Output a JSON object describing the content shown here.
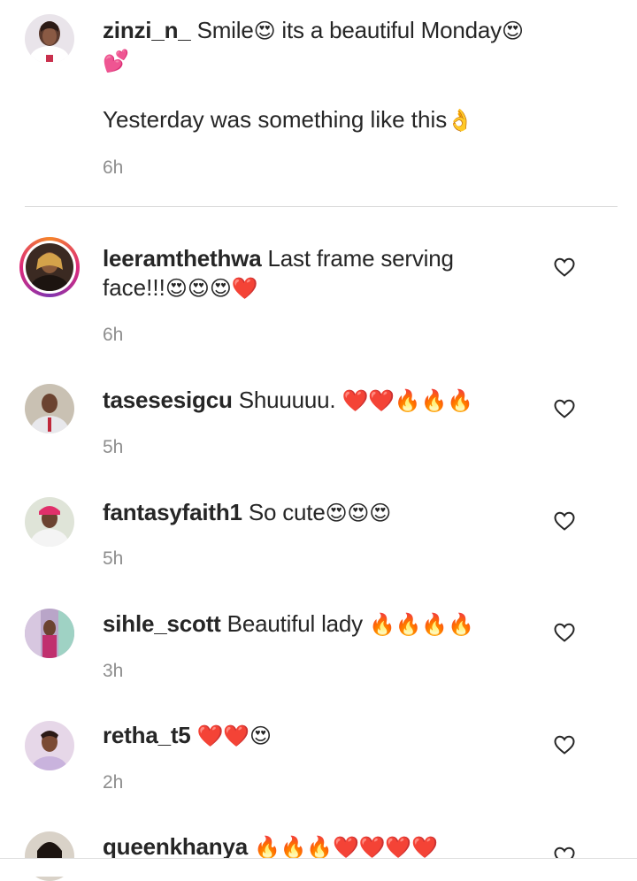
{
  "caption": {
    "username": "zinzi_n_",
    "text_part1": "Smile",
    "emoji1": "😍",
    "text_part2": " its a beautiful Monday",
    "emoji2": "😍",
    "emoji3": "💕",
    "text_line3": "Yesterday was something like this",
    "emoji4": "👌",
    "time": "6h"
  },
  "comments": [
    {
      "username": "leeramthethwa",
      "text": "Last frame serving",
      "text2": "face!!!",
      "emojis": "😍😍😍❤️",
      "time": "6h"
    },
    {
      "username": "tasesesigcu",
      "text": "Shuuuuu.",
      "emojis": "❤️❤️🔥🔥🔥",
      "time": "5h"
    },
    {
      "username": "fantasyfaith1",
      "text": "So cute",
      "emojis": "😍😍😍",
      "time": "5h"
    },
    {
      "username": "sihle_scott",
      "text": "Beautiful lady",
      "emojis": "🔥🔥🔥🔥",
      "time": "3h"
    },
    {
      "username": "retha_t5",
      "text": "",
      "emojis": "❤️❤️😍",
      "time": "2h"
    },
    {
      "username": "queenkhanya",
      "text": "",
      "emojis": "🔥🔥🔥❤️❤️❤️❤️",
      "time": ""
    }
  ],
  "icons": {
    "like": "heart-outline-icon",
    "avatar": "profile-photo"
  }
}
